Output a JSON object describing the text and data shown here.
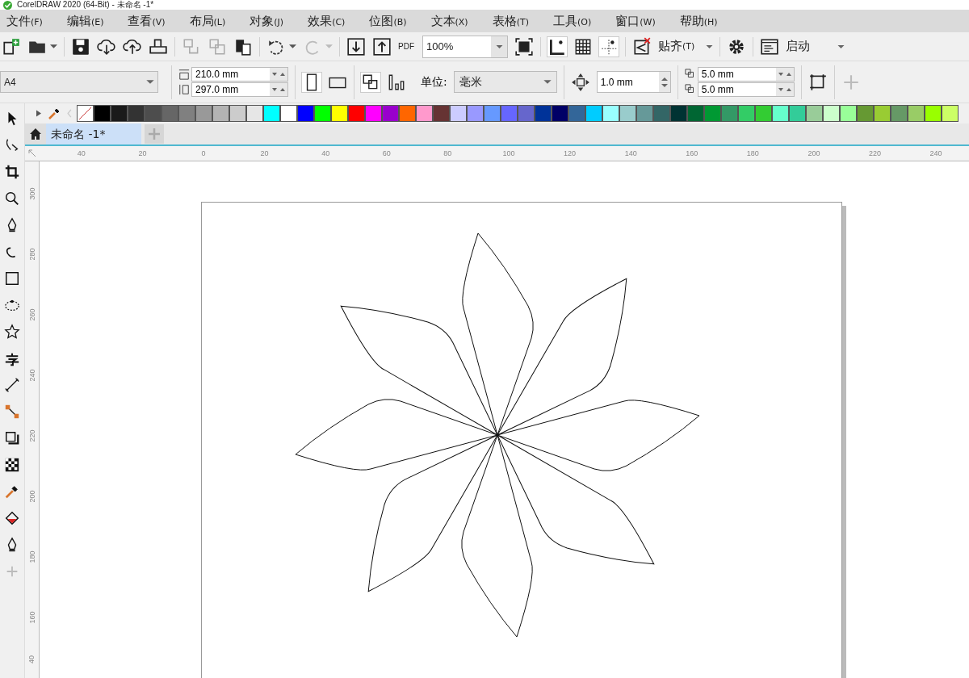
{
  "window": {
    "title": "CorelDRAW 2020 (64-Bit) - 未命名 -1*"
  },
  "menu": [
    {
      "label": "文件",
      "key": "(F)"
    },
    {
      "label": "编辑",
      "key": "(E)"
    },
    {
      "label": "查看",
      "key": "(V)"
    },
    {
      "label": "布局",
      "key": "(L)"
    },
    {
      "label": "对象",
      "key": "(J)"
    },
    {
      "label": "效果",
      "key": "(C)"
    },
    {
      "label": "位图",
      "key": "(B)"
    },
    {
      "label": "文本",
      "key": "(X)"
    },
    {
      "label": "表格",
      "key": "(T)"
    },
    {
      "label": "工具",
      "key": "(O)"
    },
    {
      "label": "窗口",
      "key": "(W)"
    },
    {
      "label": "帮助",
      "key": "(H)"
    }
  ],
  "toolbar": {
    "pdf_label": "PDF",
    "zoom": "100%",
    "snap_label": "贴齐",
    "snap_key": "(T)",
    "launch_label": "启动"
  },
  "property_bar": {
    "page_size": "A4",
    "width": "210.0 mm",
    "height": "297.0 mm",
    "units_label": "单位:",
    "units": "毫米",
    "nudge": "1.0 mm",
    "duplicate_x": "5.0 mm",
    "duplicate_y": "5.0 mm"
  },
  "palette": [
    {
      "color": "#000000"
    },
    {
      "color": "#1a1a1a"
    },
    {
      "color": "#333333"
    },
    {
      "color": "#4d4d4d"
    },
    {
      "color": "#666666"
    },
    {
      "color": "#808080"
    },
    {
      "color": "#999999"
    },
    {
      "color": "#b3b3b3"
    },
    {
      "color": "#cccccc"
    },
    {
      "color": "#e6e6e6"
    },
    {
      "color": "#00ffff"
    },
    {
      "color": "#ffffff"
    },
    {
      "color": "#0000ff"
    },
    {
      "color": "#00ff00"
    },
    {
      "color": "#ffff00"
    },
    {
      "color": "#ff0000"
    },
    {
      "color": "#ff00ff"
    },
    {
      "color": "#9900cc"
    },
    {
      "color": "#ff6600"
    },
    {
      "color": "#ff99cc"
    },
    {
      "color": "#663333"
    },
    {
      "color": "#ccccff"
    },
    {
      "color": "#9999ff"
    },
    {
      "color": "#6699ff"
    },
    {
      "color": "#6666ff"
    },
    {
      "color": "#6666cc"
    },
    {
      "color": "#003399"
    },
    {
      "color": "#000066"
    },
    {
      "color": "#336699"
    },
    {
      "color": "#00ccff"
    },
    {
      "color": "#99ffff"
    },
    {
      "color": "#99cccc"
    },
    {
      "color": "#669999"
    },
    {
      "color": "#336666"
    },
    {
      "color": "#003333"
    },
    {
      "color": "#006633"
    },
    {
      "color": "#009933"
    },
    {
      "color": "#339966"
    },
    {
      "color": "#33cc66"
    },
    {
      "color": "#33cc33"
    },
    {
      "color": "#66ffcc"
    },
    {
      "color": "#33cc99"
    },
    {
      "color": "#99cc99"
    },
    {
      "color": "#ccffcc"
    },
    {
      "color": "#99ff99"
    },
    {
      "color": "#669933"
    },
    {
      "color": "#99cc33"
    },
    {
      "color": "#669966"
    },
    {
      "color": "#99cc66"
    },
    {
      "color": "#99ff00"
    },
    {
      "color": "#ccff66"
    }
  ],
  "document_tabs": [
    {
      "title": "未命名 -1*",
      "selected": true
    }
  ],
  "horizontal_ruler": [
    "40",
    "20",
    "0",
    "20",
    "40",
    "60",
    "80",
    "100",
    "120",
    "140",
    "160",
    "180",
    "200",
    "220",
    "240"
  ],
  "vertical_ruler": [
    "300",
    "280",
    "260",
    "240",
    "220",
    "200",
    "180",
    "160",
    "40"
  ]
}
